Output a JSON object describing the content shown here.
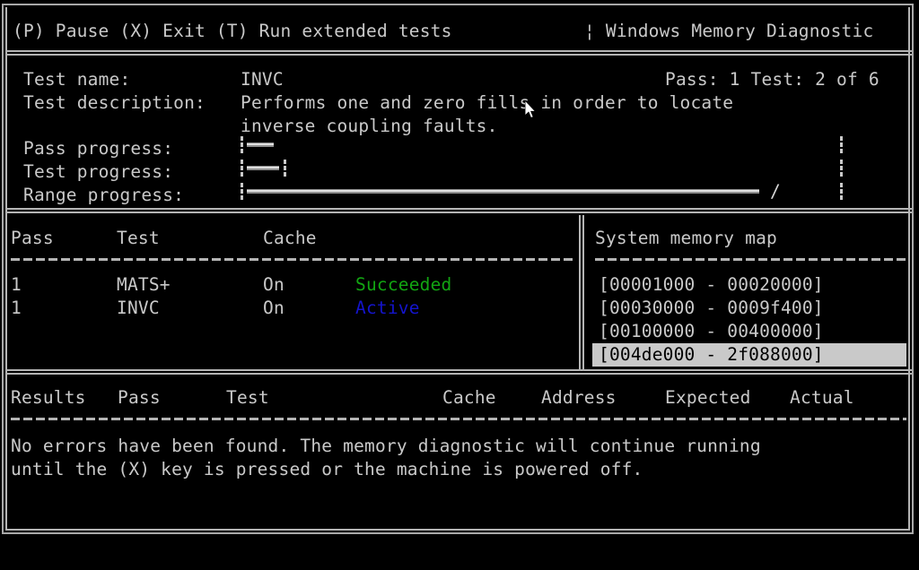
{
  "titlebar": {
    "hotkeys": "(P) Pause (X) Exit (T) Run extended tests",
    "app_title": "¦ Windows Memory Diagnostic"
  },
  "info": {
    "test_name_label": "Test name:",
    "test_name_value": "INVC",
    "test_description_label": "Test description:",
    "test_description_line1": "Performs one and zero fills in order to locate",
    "test_description_line2": "inverse coupling faults.",
    "pass_counter": "Pass: 1 Test: 2 of 6",
    "pass_progress_label": "Pass progress:",
    "test_progress_label": "Test progress:",
    "range_progress_label": "Range progress:",
    "spinner_glyph": "/"
  },
  "tests_table": {
    "headers": {
      "pass": "Pass",
      "test": "Test",
      "cache": "Cache"
    },
    "rows": [
      {
        "pass": "1",
        "test": "MATS+",
        "cache": "On",
        "status": "Succeeded",
        "status_color": "#12a512"
      },
      {
        "pass": "1",
        "test": "INVC",
        "cache": "On",
        "status": "Active",
        "status_color": "#1414cd"
      }
    ]
  },
  "memory_map": {
    "title": "System memory map",
    "entries": [
      {
        "range": "[00001000 - 00020000]",
        "selected": false
      },
      {
        "range": "[00030000 - 0009f400]",
        "selected": false
      },
      {
        "range": "[00100000 - 00400000]",
        "selected": false
      },
      {
        "range": "[004de000 - 2f088000]",
        "selected": true
      }
    ]
  },
  "results": {
    "headers": {
      "results": "Results",
      "pass": "Pass",
      "test": "Test",
      "cache": "Cache",
      "address": "Address",
      "expected": "Expected",
      "actual": "Actual"
    },
    "status_line1": "No errors have been found. The memory diagnostic will continue running",
    "status_line2": "until the (X) key is pressed or the machine is powered off."
  },
  "colors": {
    "background": "#000000",
    "foreground": "#c9c9c9",
    "rule": "#b4b4b4",
    "success": "#12a512",
    "active": "#1414cd",
    "highlight_bg": "#c9c9c9"
  }
}
